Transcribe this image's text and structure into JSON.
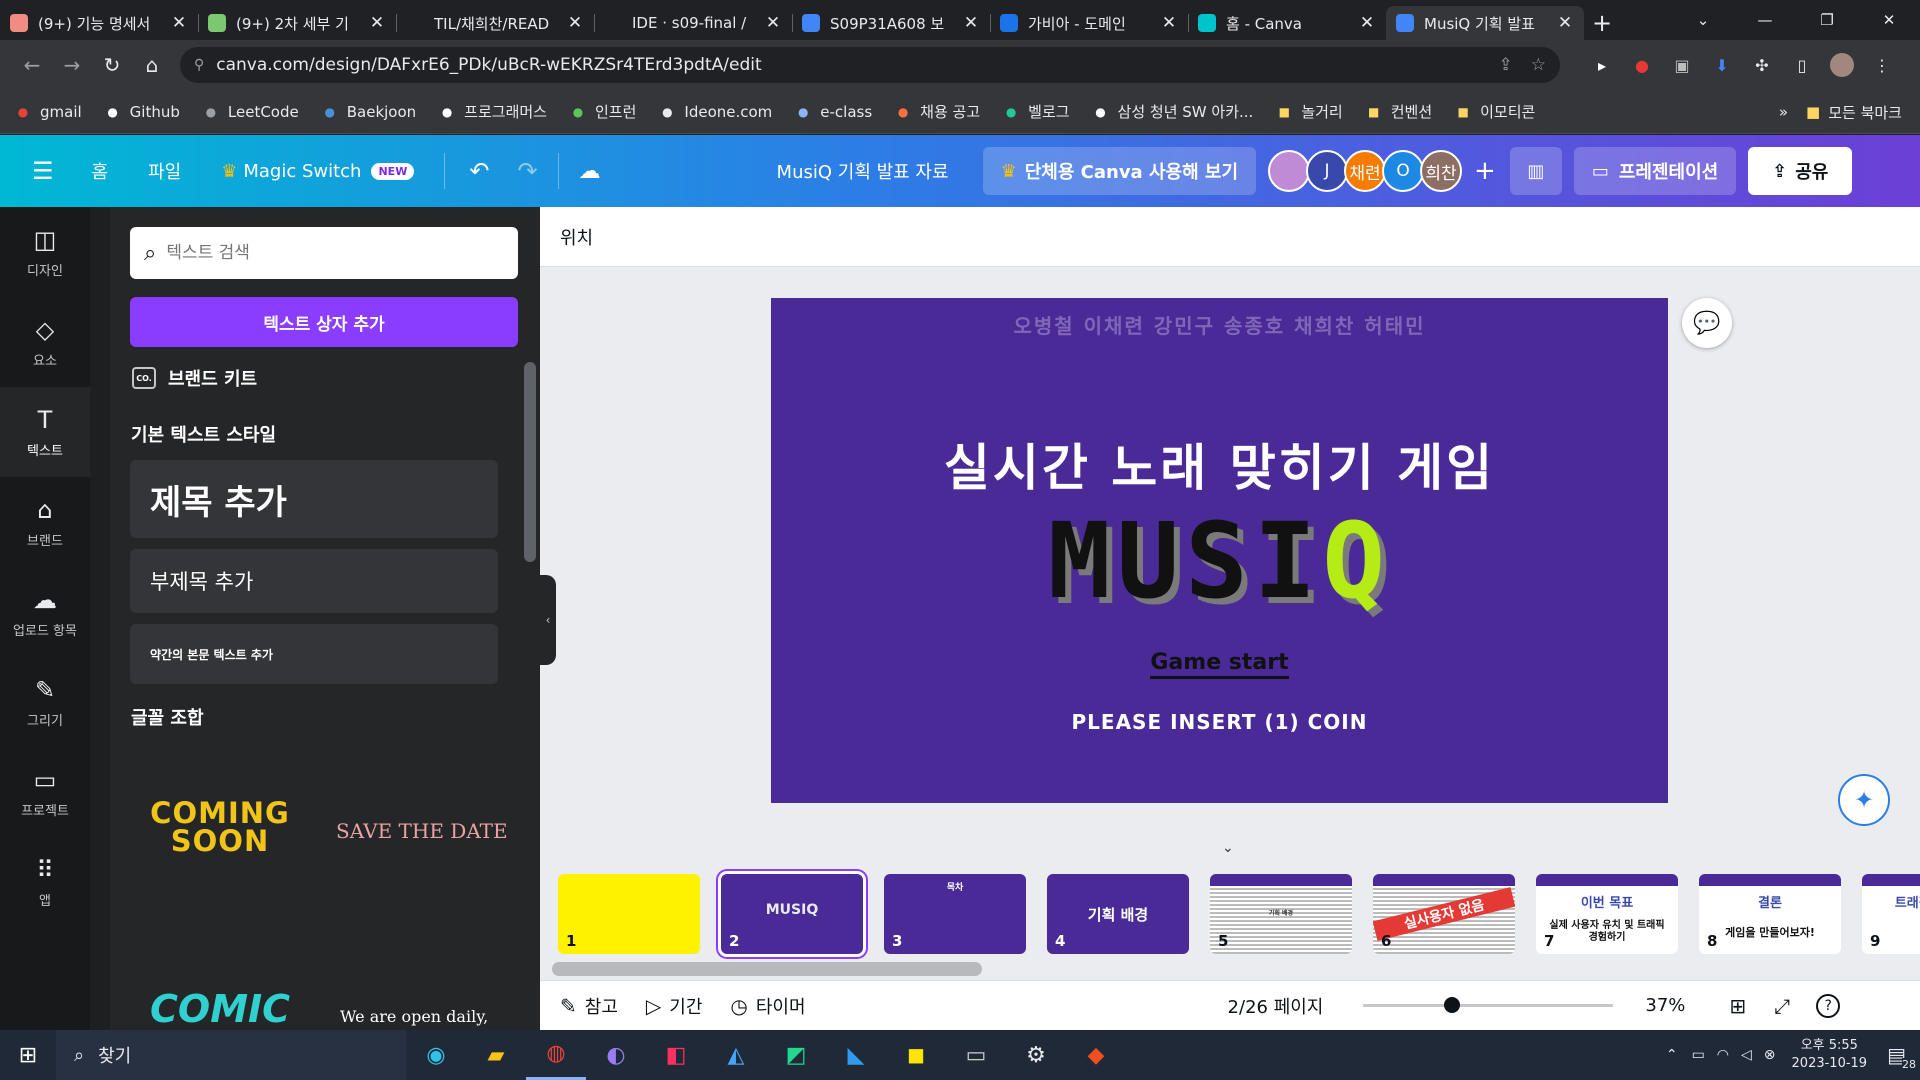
{
  "browser": {
    "tabs": [
      {
        "title": "(9+) 기능 명세서",
        "icon_color": "#f28b82",
        "active": false
      },
      {
        "title": "(9+) 2차 세부 기",
        "icon_color": "#7bc96f",
        "active": false
      },
      {
        "title": "TIL/채희찬/READ",
        "icon_color": "#202124",
        "active": false
      },
      {
        "title": "IDE · s09-final /",
        "icon_color": "#202124",
        "active": false
      },
      {
        "title": "S09P31A608 보",
        "icon_color": "#4285f4",
        "active": false
      },
      {
        "title": "가비아 - 도메인",
        "icon_color": "#1a73e8",
        "active": false
      },
      {
        "title": "홈 - Canva",
        "icon_color": "#00c4cc",
        "active": false
      },
      {
        "title": "MusiQ 기획 발표",
        "icon_color": "#4285f4",
        "active": true
      }
    ],
    "url": "canva.com/design/DAFxrE6_PDk/uBcR-wEKRZSr4TErd3pdtA/edit",
    "bookmarks": [
      "gmail",
      "Github",
      "LeetCode",
      "Baekjoon",
      "프로그래머스",
      "인프런",
      "Ideone.com",
      "e-class",
      "채용 공고",
      "벨로그",
      "삼성 청년 SW 아카...",
      "놀거리",
      "컨벤션",
      "이모티콘"
    ],
    "bookmarks_more": "»",
    "all_bookmarks": "모든 북마크"
  },
  "canva": {
    "menu": {
      "home": "홈",
      "file": "파일",
      "magic_switch": "Magic Switch",
      "new_badge": "NEW"
    },
    "doc_title": "MusiQ 기획 발표 자료",
    "team_cta": "단체용 Canva 사용해 보기",
    "avatars": [
      {
        "label": "",
        "color": "#c08bd6"
      },
      {
        "label": "J",
        "color": "#3949ab"
      },
      {
        "label": "채련",
        "color": "#f57c00"
      },
      {
        "label": "O",
        "color": "#1e88e5"
      },
      {
        "label": "희찬",
        "color": "#8d6e63"
      }
    ],
    "add_collaborator": "+",
    "present_label": "프레젠테이션",
    "share_label": "공유",
    "rail": [
      {
        "label": "디자인",
        "icon": "layout-icon"
      },
      {
        "label": "요소",
        "icon": "shapes-icon"
      },
      {
        "label": "텍스트",
        "icon": "text-icon",
        "active": true
      },
      {
        "label": "브랜드",
        "icon": "brand-icon"
      },
      {
        "label": "업로드 항목",
        "icon": "upload-cloud-icon"
      },
      {
        "label": "그리기",
        "icon": "draw-icon"
      },
      {
        "label": "프로젝트",
        "icon": "folder-icon"
      },
      {
        "label": "앱",
        "icon": "apps-grid-icon"
      }
    ],
    "panel": {
      "search_placeholder": "텍스트 검색",
      "add_textbox": "텍스트 상자 추가",
      "brand_kit": "브랜드 키트",
      "basic_styles_title": "기본 텍스트 스타일",
      "heading": "제목 추가",
      "subheading": "부제목 추가",
      "body": "약간의 본문 텍스트 추가",
      "combos_title": "글꼴 조합",
      "combos": [
        "COMING SOON",
        "SAVE THE DATE",
        "COMIC",
        "We are open daily,"
      ]
    },
    "position_label": "위치",
    "slide": {
      "names": "오병철  이채련  강민구  송종호  채희찬  허태민",
      "subtitle": "실시간 노래 맞히기 게임",
      "logo_main": "MUSI",
      "logo_q": "Q",
      "game_start": "Game start",
      "coin": "PLEASE INSERT (1) COIN"
    },
    "pages": [
      {
        "num": "1",
        "bg": "#fff200",
        "text": ""
      },
      {
        "num": "2",
        "bg": "#4a2a96",
        "text": "MUSIQ"
      },
      {
        "num": "3",
        "bg": "#4a2a96",
        "text": "목차"
      },
      {
        "num": "4",
        "bg": "#4a2a96",
        "text": "기획 배경"
      },
      {
        "num": "5",
        "bg": "#f5f5f5",
        "text": "기획 배경"
      },
      {
        "num": "6",
        "bg": "#f5f5f5",
        "text": "실사용자 없음"
      },
      {
        "num": "7",
        "bg": "#ffffff",
        "text": "이번 목표"
      },
      {
        "num": "8",
        "bg": "#ffffff",
        "text": "결론"
      },
      {
        "num": "9",
        "bg": "#ffffff",
        "text": "트래픽의 늘어"
      }
    ],
    "page7_sub": "실제 사용자 유치 및 트래픽 경험하기",
    "page8_sub": "게임을 만들어보자!",
    "bottom": {
      "notes": "참고",
      "duration": "기간",
      "timer": "타이머",
      "page_indicator": "2/26 페이지",
      "zoom": "37%",
      "zoom_fraction": 0.37
    }
  },
  "taskbar": {
    "search": "찾기",
    "time": "오후 5:55",
    "date": "2023-10-19",
    "notifications": "28"
  }
}
